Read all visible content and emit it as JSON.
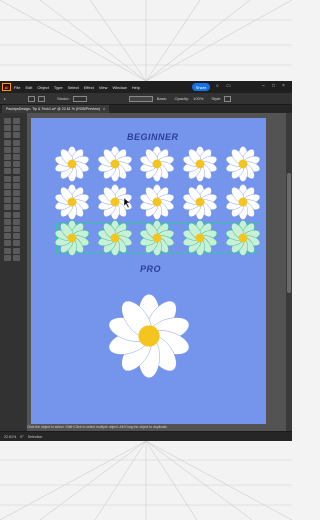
{
  "menu": {
    "logo": "Ai",
    "items": [
      "File",
      "Edit",
      "Object",
      "Type",
      "Select",
      "Effect",
      "View",
      "Window",
      "Help"
    ],
    "share_label": "Share"
  },
  "control": {
    "stroke_label": "Stroke:",
    "basic_label": "Basic",
    "opacity_label": "Opacity:",
    "opacity_value": "100%",
    "style_label": "Style:"
  },
  "document": {
    "tab_title": "PackIpsDesign- Tip & Trick1.ai* @ 22.61 % (RGB/Preview)"
  },
  "artboard": {
    "title_top": "BEGINNER",
    "title_bottom": "PRO",
    "background": "#7594ec"
  },
  "status": {
    "hint": "Click the object to select. Shift+Click to select multiple object. Alt+Drag the object to duplicate.",
    "zoom": "22.61%",
    "rotation": "0°",
    "mode": "Selection"
  },
  "colors": {
    "petal": "#ffffff",
    "center": "#f4c51f",
    "selection_tint": "#c9f0d6",
    "selection_box": "#37c6a0"
  }
}
